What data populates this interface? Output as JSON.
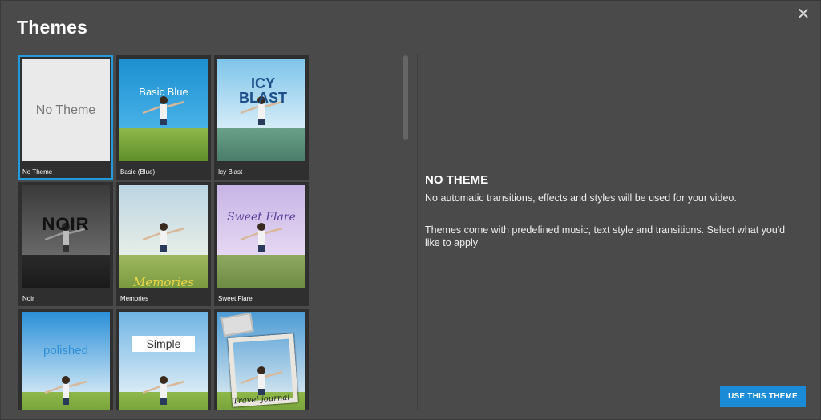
{
  "dialog": {
    "title": "Themes",
    "close_icon": "close-icon"
  },
  "themes": [
    {
      "caption": "No Theme",
      "art_text": "No Theme",
      "selected": true
    },
    {
      "caption": "Basic (Blue)",
      "art_text": "Basic Blue",
      "selected": false
    },
    {
      "caption": "Icy Blast",
      "art_text": "ICY BLAST",
      "selected": false
    },
    {
      "caption": "Noir",
      "art_text": "NOIR",
      "selected": false
    },
    {
      "caption": "Memories",
      "art_text": "Memories",
      "selected": false
    },
    {
      "caption": "Sweet Flare",
      "art_text": "Sweet Flare",
      "selected": false
    },
    {
      "caption": "",
      "art_text": "polished",
      "selected": false
    },
    {
      "caption": "",
      "art_text": "Simple",
      "selected": false
    },
    {
      "caption": "",
      "art_text": "Travel journal",
      "selected": false
    }
  ],
  "details": {
    "name": "NO THEME",
    "description": "No automatic transitions, effects and styles will be used for your video.",
    "note": "Themes come with predefined music, text style and transitions. Select what you'd like to apply"
  },
  "actions": {
    "use_label": "USE THIS THEME"
  },
  "colors": {
    "accent": "#1a8bd6",
    "selected_border": "#1f9bde",
    "background": "#4a4a4a"
  }
}
